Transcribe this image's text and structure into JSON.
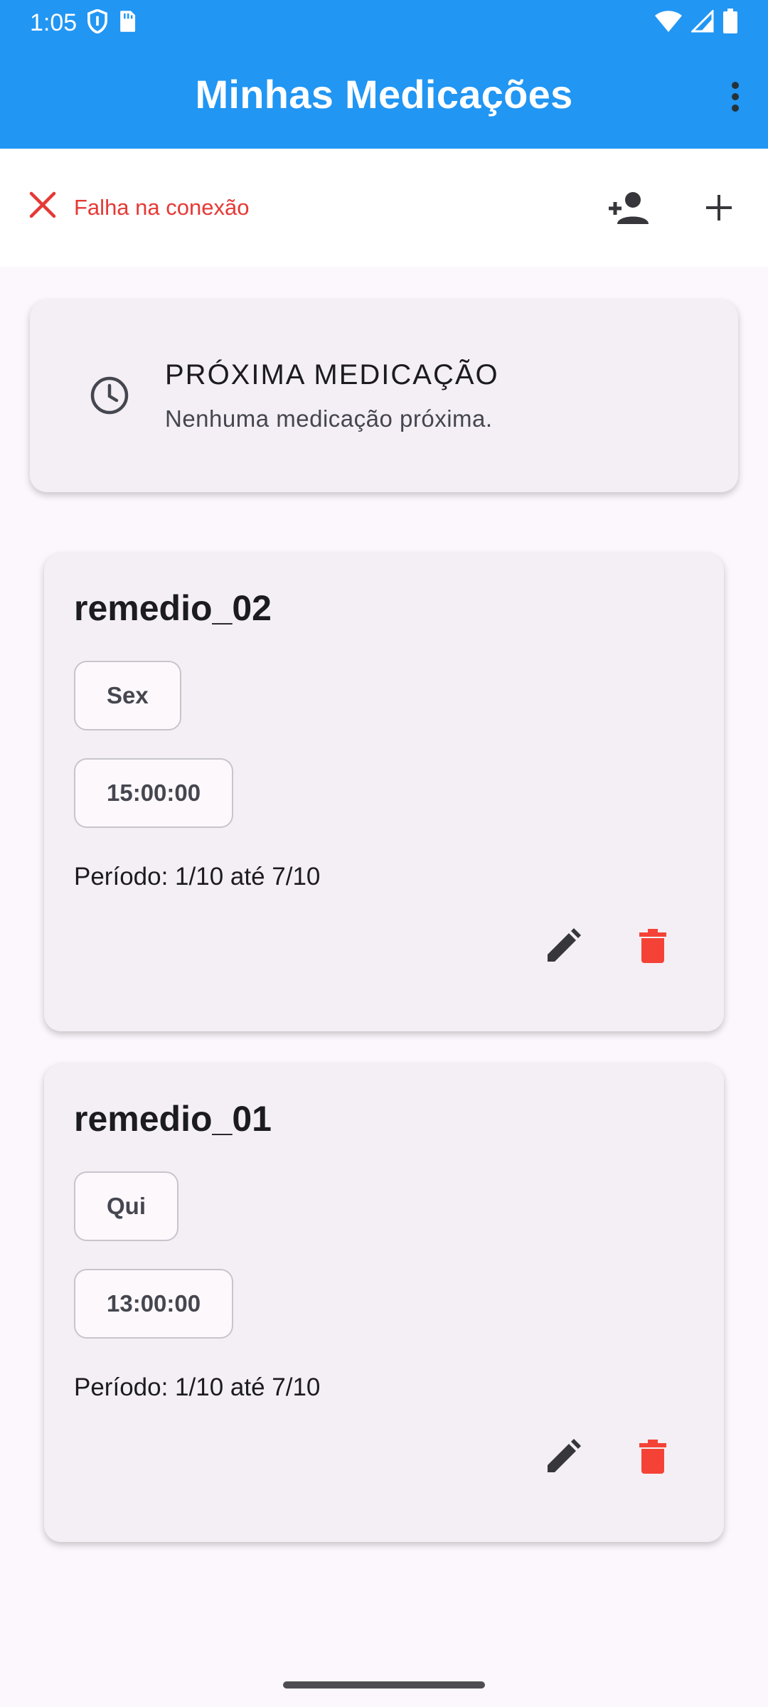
{
  "status_bar": {
    "time": "1:05"
  },
  "app_bar": {
    "title": "Minhas Medicações"
  },
  "connection": {
    "error_text": "Falha na conexão"
  },
  "next_medication": {
    "title": "PRÓXIMA MEDICAÇÃO",
    "subtitle": "Nenhuma medicação próxima."
  },
  "medications": [
    {
      "name": "remedio_02",
      "day": "Sex",
      "time": "15:00:00",
      "period": "Período: 1/10 até 7/10"
    },
    {
      "name": "remedio_01",
      "day": "Qui",
      "time": "13:00:00",
      "period": "Período: 1/10 até 7/10"
    }
  ],
  "colors": {
    "app_bar": "#2196f3",
    "error": "#e53935",
    "delete": "#f44336",
    "background": "#fcf7fc",
    "card": "#f4eff4"
  }
}
